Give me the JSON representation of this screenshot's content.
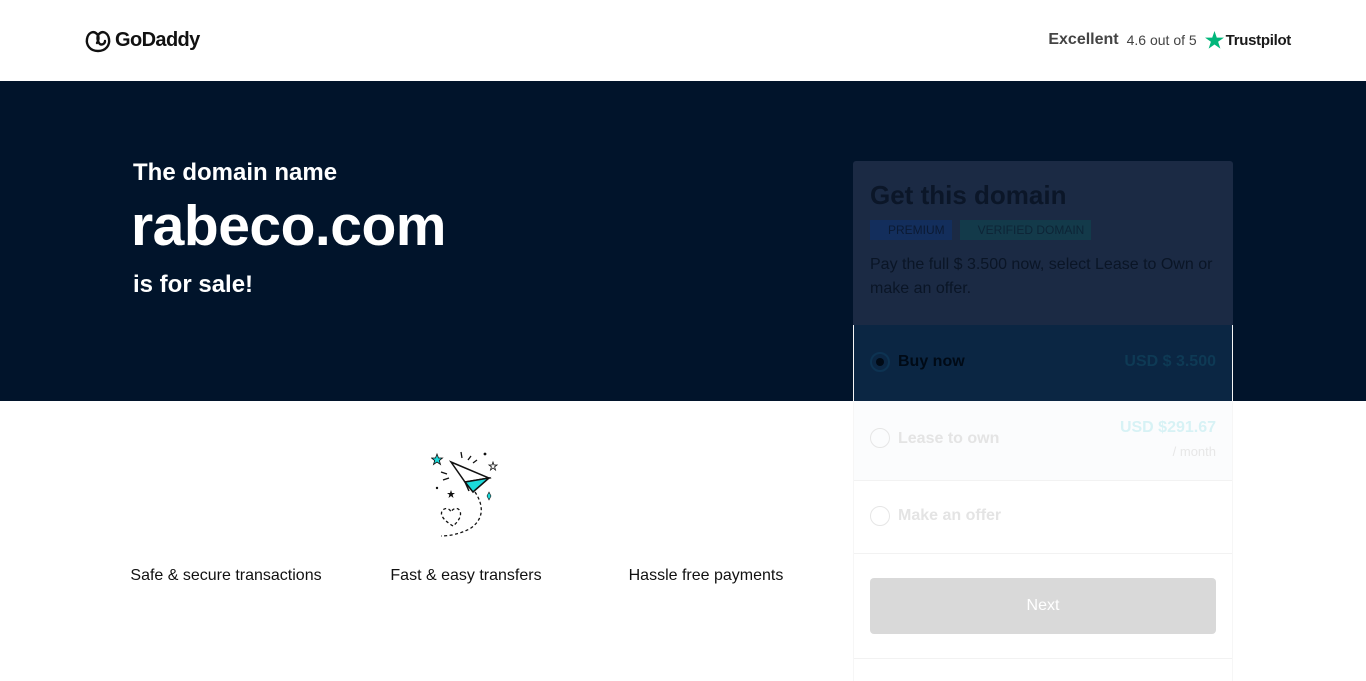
{
  "header": {
    "logo_text": "GoDaddy",
    "trust_rating": "Excellent",
    "trust_score": "4.6 out of 5",
    "trust_brand": "Trustpilot"
  },
  "hero": {
    "pre_text": "The domain name",
    "domain": "rabeco.com",
    "post_text": "is for sale!"
  },
  "features": [
    {
      "label": "Safe & secure transactions"
    },
    {
      "label": "Fast & easy transfers"
    },
    {
      "label": "Hassle free payments"
    }
  ],
  "card": {
    "title": "Get this domain",
    "badges": [
      "PREMIUM",
      "VERIFIED DOMAIN"
    ],
    "description": "Pay the full $ 3.500 now, select Lease to Own or make an offer.",
    "options": [
      {
        "label": "Buy now",
        "price": "USD $ 3.500",
        "selected": true
      },
      {
        "label": "Lease to own",
        "price": "USD $291.67",
        "sub": "/ month",
        "selected": false
      },
      {
        "label": "Make an offer",
        "selected": false
      }
    ],
    "next_label": "Next"
  },
  "colors": {
    "hero_bg": "#01142b",
    "trustpilot_green": "#00b67a",
    "illustration_teal": "#1bdbdb"
  },
  "icons": {
    "logo": "godaddy-logo-icon",
    "trust": "trustpilot-star-icon",
    "feature_2": "paper-plane-icon"
  }
}
